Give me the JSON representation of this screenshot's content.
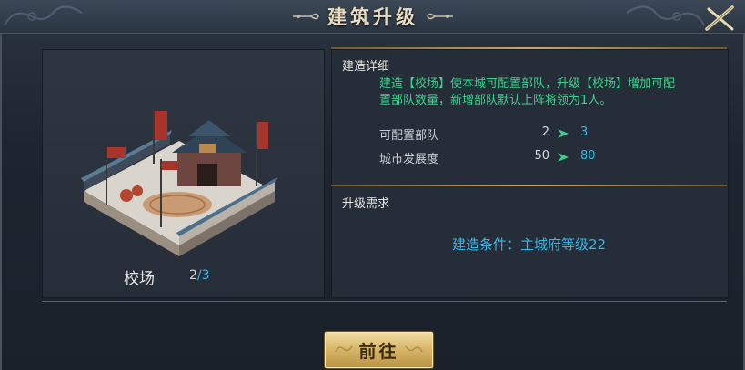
{
  "window": {
    "title": "建筑升级"
  },
  "building": {
    "name": "校场",
    "count_current": "2",
    "count_separator": "/",
    "count_max": "3"
  },
  "details": {
    "section_title": "建造详细",
    "description_line1": "建造【校场】使本城可配置部队，升级【校场】增加可配",
    "description_line2": "置部队数量，新增部队默认上阵将领为1人。",
    "stats": [
      {
        "label": "可配置部队",
        "from": "2",
        "to": "3"
      },
      {
        "label": "城市发展度",
        "from": "50",
        "to": "80"
      }
    ]
  },
  "requirements": {
    "section_title": "升级需求",
    "condition": "建造条件：主城府等级22"
  },
  "actions": {
    "go_label": "前往"
  },
  "colors": {
    "accent_green": "#3fd18b",
    "accent_blue": "#35b7e8",
    "gold": "#c8a96a"
  }
}
